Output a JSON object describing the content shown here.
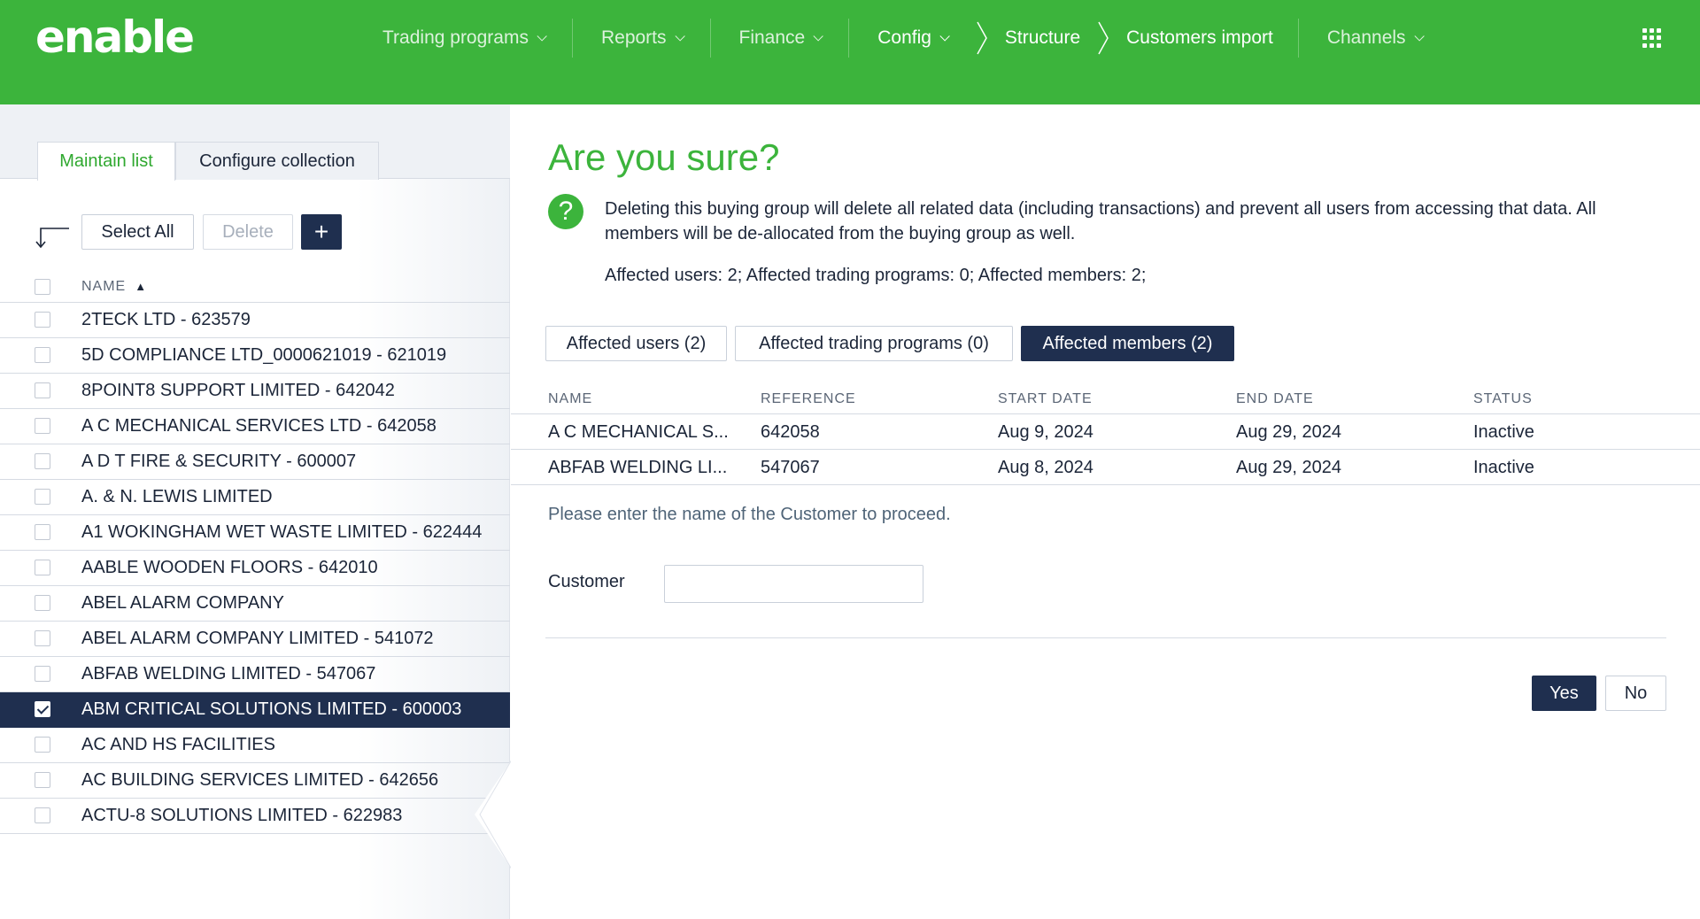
{
  "brand": {
    "logo_text": "enable",
    "color_primary": "#3cb43c",
    "color_dark": "#1f2f4f"
  },
  "nav": {
    "items": [
      {
        "label": "Trading programs",
        "has_caret": true
      },
      {
        "label": "Reports",
        "has_caret": true
      },
      {
        "label": "Finance",
        "has_caret": true
      },
      {
        "label": "Config",
        "has_caret": true
      },
      {
        "label": "Structure",
        "has_caret": false
      },
      {
        "label": "Customers import",
        "has_caret": false
      },
      {
        "label": "Channels",
        "has_caret": true
      }
    ],
    "apps_icon": "grid-icon"
  },
  "left": {
    "tabs": {
      "maintain": "Maintain list",
      "configure": "Configure collection"
    },
    "toolbar": {
      "select_all": "Select All",
      "delete": "Delete",
      "add": "+"
    },
    "column_header": "NAME",
    "sort_indicator": "▲",
    "rows": [
      "2TECK LTD - 623579",
      "5D COMPLIANCE LTD_0000621019 - 621019",
      "8POINT8 SUPPORT LIMITED - 642042",
      "A C MECHANICAL SERVICES LTD - 642058",
      "A D T FIRE & SECURITY - 600007",
      "A. & N. LEWIS LIMITED",
      "A1 WOKINGHAM WET WASTE LIMITED - 622444",
      "AABLE WOODEN FLOORS - 642010",
      "ABEL ALARM COMPANY",
      "ABEL ALARM COMPANY LIMITED - 541072",
      "ABFAB WELDING LIMITED - 547067",
      "ABM CRITICAL SOLUTIONS LIMITED - 600003",
      "AC AND HS FACILITIES",
      "AC BUILDING SERVICES LIMITED - 642656",
      "ACTU-8 SOLUTIONS LIMITED - 622983"
    ],
    "selected_index": 11
  },
  "dialog": {
    "title": "Are you sure?",
    "message": "Deleting this buying group will delete all related data (including transactions) and prevent all users from accessing that data. All members will be de-allocated from the buying group as well.",
    "affected_summary": "Affected users: 2; Affected trading programs: 0; Affected members: 2;",
    "tabs": {
      "users": "Affected users (2)",
      "programs": "Affected trading programs (0)",
      "members": "Affected members (2)"
    },
    "active_tab": "members",
    "table": {
      "headers": {
        "name": "NAME",
        "reference": "REFERENCE",
        "start": "START DATE",
        "end": "END DATE",
        "status": "STATUS"
      },
      "rows": [
        {
          "name": "A C MECHANICAL S...",
          "reference": "642058",
          "start": "Aug 9, 2024",
          "end": "Aug 29, 2024",
          "status": "Inactive"
        },
        {
          "name": "ABFAB WELDING LI...",
          "reference": "547067",
          "start": "Aug 8, 2024",
          "end": "Aug 29, 2024",
          "status": "Inactive"
        }
      ]
    },
    "prompt": "Please enter the name of the Customer to proceed.",
    "field_label": "Customer",
    "field_value": "",
    "yes": "Yes",
    "no": "No"
  }
}
